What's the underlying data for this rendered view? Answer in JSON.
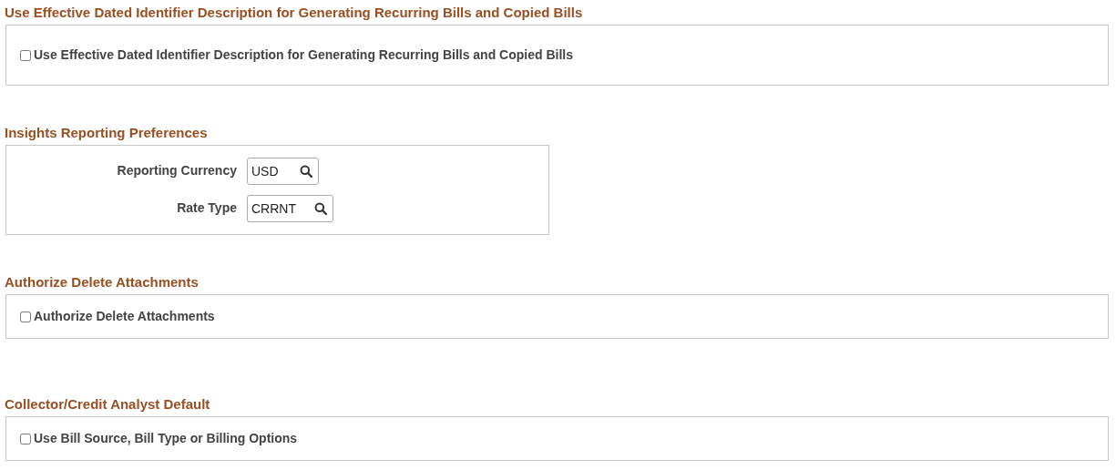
{
  "sections": [
    {
      "kind": "checkbox",
      "title": "Use Effective Dated Identifier Description for Generating Recurring Bills and Copied Bills",
      "checkbox": {
        "label": "Use Effective Dated Identifier Description for Generating Recurring Bills and Copied Bills",
        "checked": false
      }
    },
    {
      "kind": "fields",
      "title": "Insights Reporting Preferences",
      "fields": [
        {
          "label": "Reporting Currency",
          "value": "USD"
        },
        {
          "label": "Rate Type",
          "value": "CRRNT"
        }
      ]
    },
    {
      "kind": "checkbox",
      "title": "Authorize Delete Attachments",
      "checkbox": {
        "label": "Authorize Delete Attachments",
        "checked": false
      }
    },
    {
      "kind": "checkbox",
      "title": "Collector/Credit Analyst Default",
      "checkbox": {
        "label": "Use Bill Source, Bill Type or Billing Options",
        "checked": false
      }
    }
  ]
}
